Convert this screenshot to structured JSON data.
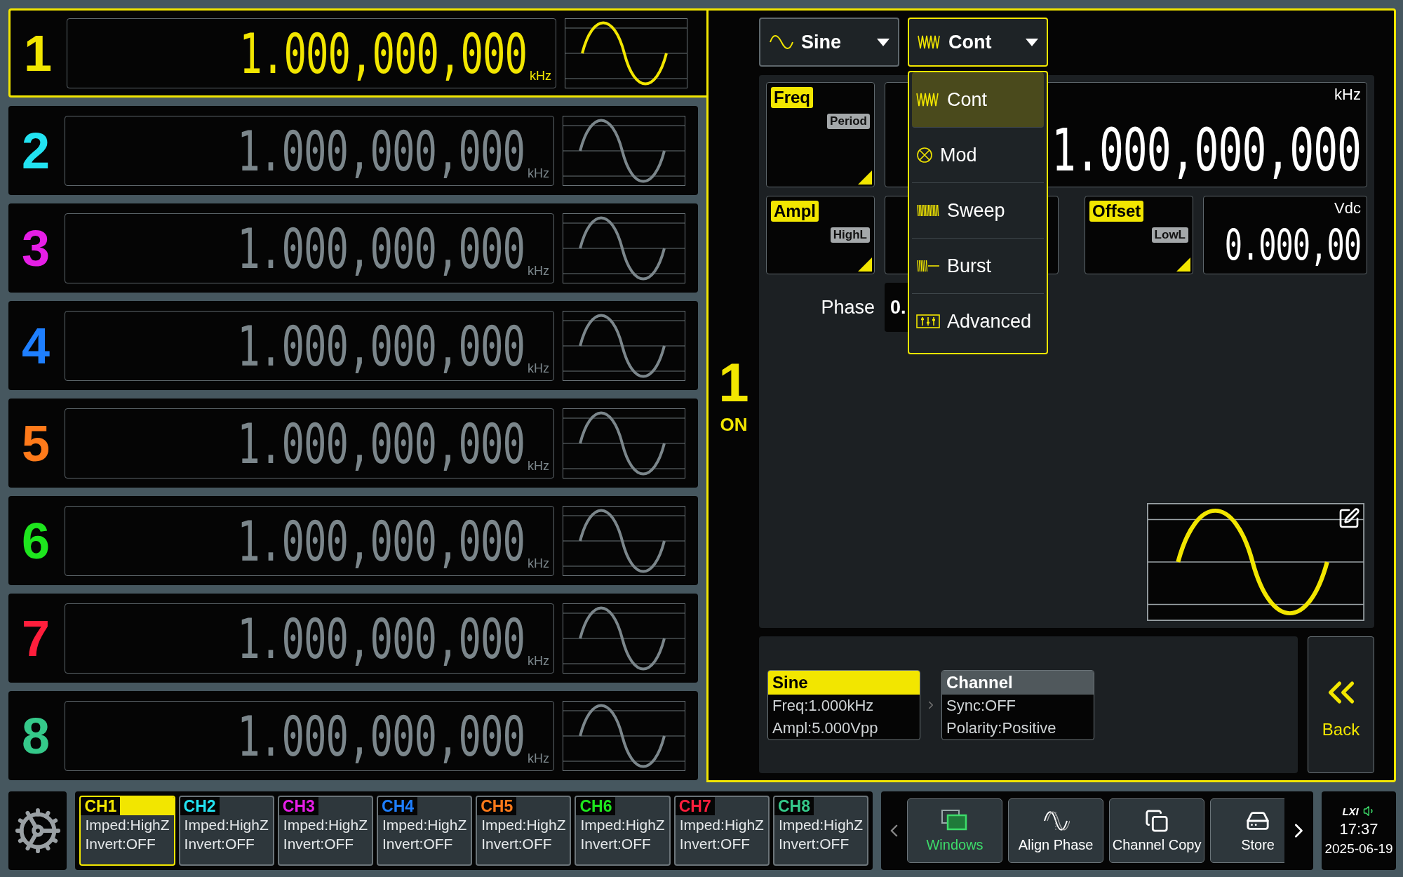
{
  "channels": [
    {
      "number": "1",
      "value": "1.000,000,000",
      "unit": "kHz",
      "color": "#f2e600",
      "selected": true
    },
    {
      "number": "2",
      "value": "1.000,000,000",
      "unit": "kHz",
      "color": "#22e3f2",
      "selected": false
    },
    {
      "number": "3",
      "value": "1.000,000,000",
      "unit": "kHz",
      "color": "#e61ee6",
      "selected": false
    },
    {
      "number": "4",
      "value": "1.000,000,000",
      "unit": "kHz",
      "color": "#1e7fff",
      "selected": false
    },
    {
      "number": "5",
      "value": "1.000,000,000",
      "unit": "kHz",
      "color": "#ff7a1a",
      "selected": false
    },
    {
      "number": "6",
      "value": "1.000,000,000",
      "unit": "kHz",
      "color": "#1ee61e",
      "selected": false
    },
    {
      "number": "7",
      "value": "1.000,000,000",
      "unit": "kHz",
      "color": "#ff1e3c",
      "selected": false
    },
    {
      "number": "8",
      "value": "1.000,000,000",
      "unit": "kHz",
      "color": "#35c98a",
      "selected": false
    }
  ],
  "active_channel": {
    "number": "1",
    "state": "ON"
  },
  "waveform_select": {
    "label": "Sine"
  },
  "mode_select": {
    "label": "Cont",
    "open": true
  },
  "mode_menu": [
    {
      "kind": "cont",
      "label": "Cont",
      "selected": true
    },
    {
      "kind": "mod",
      "label": "Mod",
      "selected": false
    },
    {
      "kind": "sweep",
      "label": "Sweep",
      "selected": false
    },
    {
      "kind": "burst",
      "label": "Burst",
      "selected": false
    },
    {
      "kind": "advanced",
      "label": "Advanced",
      "selected": false
    }
  ],
  "params": {
    "freq": {
      "label": "Freq",
      "alt": "Period",
      "unit": "kHz",
      "value": "1.000,000,000"
    },
    "ampl": {
      "label": "Ampl",
      "alt": "HighL"
    },
    "offset": {
      "label": "Offset",
      "alt": "LowL",
      "unit": "Vdc",
      "value": "0.000,00"
    },
    "phase": {
      "label": "Phase",
      "value": "0."
    }
  },
  "summary": [
    {
      "title": "Sine",
      "lines": [
        "Freq:1.000kHz",
        "Ampl:5.000Vpp"
      ],
      "selected": true
    },
    {
      "title": "Channel",
      "lines": [
        "Sync:OFF",
        "Polarity:Positive"
      ],
      "selected": false
    }
  ],
  "back_button": {
    "label": "Back"
  },
  "channel_tabs": [
    {
      "label": "CH1",
      "lines": [
        "Imped:HighZ",
        "Invert:OFF"
      ],
      "selected": true
    },
    {
      "label": "CH2",
      "lines": [
        "Imped:HighZ",
        "Invert:OFF"
      ],
      "selected": false
    },
    {
      "label": "CH3",
      "lines": [
        "Imped:HighZ",
        "Invert:OFF"
      ],
      "selected": false
    },
    {
      "label": "CH4",
      "lines": [
        "Imped:HighZ",
        "Invert:OFF"
      ],
      "selected": false
    },
    {
      "label": "CH5",
      "lines": [
        "Imped:HighZ",
        "Invert:OFF"
      ],
      "selected": false
    },
    {
      "label": "CH6",
      "lines": [
        "Imped:HighZ",
        "Invert:OFF"
      ],
      "selected": false
    },
    {
      "label": "CH7",
      "lines": [
        "Imped:HighZ",
        "Invert:OFF"
      ],
      "selected": false
    },
    {
      "label": "CH8",
      "lines": [
        "Imped:HighZ",
        "Invert:OFF"
      ],
      "selected": false
    }
  ],
  "function_keys": [
    {
      "kind": "windows",
      "label": "Windows",
      "selected": true
    },
    {
      "kind": "align",
      "label": "Align Phase",
      "selected": false
    },
    {
      "kind": "copy",
      "label": "Channel Copy",
      "selected": false
    },
    {
      "kind": "store",
      "label": "Store",
      "selected": false
    }
  ],
  "status": {
    "logo": "LXI",
    "time": "17:37",
    "date": "2025-06-19"
  }
}
